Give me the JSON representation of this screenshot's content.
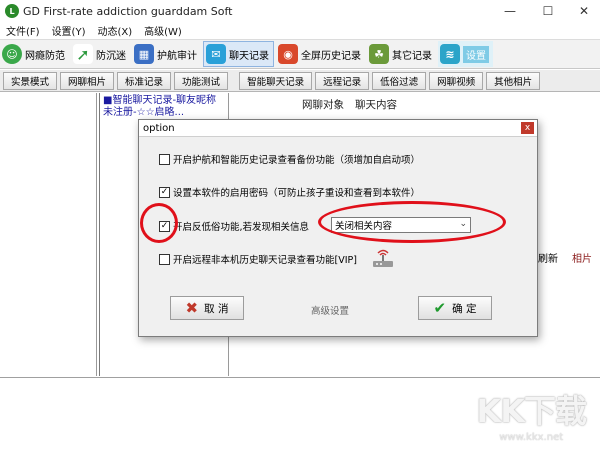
{
  "window": {
    "title": "GD First-rate addiction guarddam Soft",
    "app_icon_letter": "L",
    "minimize": "—",
    "maximize": "☐",
    "close": "✕"
  },
  "menu": [
    "文件(F)",
    "设置(Y)",
    "动态(X)",
    "高级(W)"
  ],
  "toolbar": [
    {
      "label": "网瘾防范",
      "icon": "face-icon",
      "color": "#3aa84a"
    },
    {
      "label": "防沉迷",
      "icon": "arrow-icon",
      "color": "#2d9a3e"
    },
    {
      "label": "护航审计",
      "icon": "audit-icon",
      "color": "#3b6fc4"
    },
    {
      "label": "聊天记录",
      "icon": "chat-icon",
      "color": "#29a0d8"
    },
    {
      "label": "全屏历史记录",
      "icon": "history-icon",
      "color": "#d9482b"
    },
    {
      "label": "其它记录",
      "icon": "records-icon",
      "color": "#6b9a3a"
    },
    {
      "label": "设置",
      "icon": "wifi-icon",
      "color": "#2ba4c9"
    }
  ],
  "tabs": [
    "实景模式",
    "网聊相片",
    "标准记录",
    "功能测试",
    "智能聊天记录",
    "远程记录",
    "低俗过滤",
    "网聊视频",
    "其他相片"
  ],
  "list": {
    "line1": "■智能聊天记录-聊友昵称",
    "line2": "未注册-☆☆启略..."
  },
  "right": {
    "col1": "网聊对象",
    "col2": "聊天内容",
    "action1": "刷新",
    "action2": "相片"
  },
  "dialog": {
    "title": "option",
    "close": "x",
    "options": [
      {
        "label": "开启护航和智能历史记录查看备份功能（须增加自启动项）",
        "checked": false
      },
      {
        "label": "设置本软件的启用密码（可防止孩子重设和查看到本软件）",
        "checked": true
      },
      {
        "label": "开启反低俗功能,若发现相关信息",
        "checked": true
      },
      {
        "label": "开启远程非本机历史聊天记录查看功能[VIP]",
        "checked": false
      }
    ],
    "select_value": "关闭相关内容",
    "cancel_label": "取 消",
    "ok_label": "确 定",
    "advanced_label": "高级设置"
  },
  "watermark": {
    "main": "KK下载",
    "url": "www.kkx.net"
  },
  "colors": {
    "annotation_red": "#e0101a",
    "ok_green": "#1f9a2e",
    "cancel_red": "#c0392b"
  }
}
